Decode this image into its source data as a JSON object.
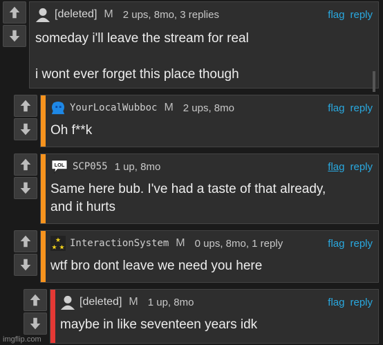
{
  "comments": [
    {
      "username": "[deleted]",
      "badge": "M",
      "stats": "2 ups, 8mo, 3 replies",
      "flag": "flag",
      "reply": "reply",
      "body": [
        "someday i'll leave the stream for real",
        "",
        "i wont ever forget this place though"
      ],
      "avatar_icon": "user-silhouette-icon",
      "stripe_color": ""
    },
    {
      "username": "YourLocalWubboc",
      "badge": "M",
      "stats": "2 ups, 8mo",
      "flag": "flag",
      "reply": "reply",
      "body": [
        "Oh f**k"
      ],
      "avatar_icon": "blue-blob-icon",
      "stripe_color": "#f7931e"
    },
    {
      "username": "SCP055",
      "badge": "",
      "stats": "1 up, 8mo",
      "flag": "flag",
      "reply": "reply",
      "body": [
        "Same here bub. I've had a taste of that already,",
        "and it hurts"
      ],
      "avatar_icon": "lol-speech-bubble-icon",
      "avatar_text": "LOL",
      "stripe_color": "#f7931e"
    },
    {
      "username": "InteractionSystem",
      "badge": "M",
      "stats": "0 ups, 8mo, 1 reply",
      "flag": "flag",
      "reply": "reply",
      "body": [
        "wtf bro dont leave we need you here"
      ],
      "avatar_icon": "stars-icon",
      "stripe_color": "#f7931e"
    },
    {
      "username": "[deleted]",
      "badge": "M",
      "stats": "1 up, 8mo",
      "flag": "flag",
      "reply": "reply",
      "body": [
        "maybe in like seventeen years idk"
      ],
      "avatar_icon": "user-silhouette-icon",
      "stripe_color": "#e53935"
    }
  ],
  "watermark": "imgflip.com",
  "colors": {
    "link": "#29a9e0",
    "background": "#1a1a1a",
    "card": "#2e2e2e"
  }
}
